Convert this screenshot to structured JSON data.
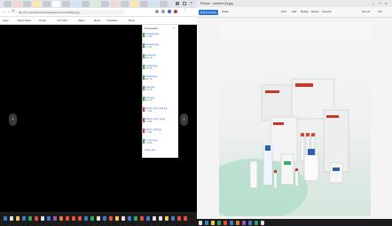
{
  "browser": {
    "url": "file:///C:/Users/admin/Downloads/camera%20(2).jpg",
    "bookmarks": [
      "Apps",
      "Bookmarks",
      "Gmail",
      "YouTube",
      "Maps",
      "News",
      "Translate",
      "Drive"
    ],
    "downloads_title": "Downloads",
    "downloads": [
      {
        "name": "camera(2).jpg",
        "sub": "1.2 MB"
      },
      {
        "name": "camera(1).jpg",
        "sub": "1.1 MB"
      },
      {
        "name": "camera.jpg",
        "sub": "980 KB"
      },
      {
        "name": "image(3).jpg",
        "sub": "870 KB"
      },
      {
        "name": "image(2).jpg",
        "sub": "864 KB"
      },
      {
        "name": "image.jpg",
        "sub": "702 KB"
      },
      {
        "name": "photo.jpg",
        "sub": "655 KB"
      },
      {
        "name": "product_shot_final.jpg",
        "sub": "2.4 MB"
      },
      {
        "name": "product_shot_v2.jpg",
        "sub": "2.3 MB"
      },
      {
        "name": "product_shot.jpg",
        "sub": "2.2 MB"
      },
      {
        "name": "kit_photo.jpg",
        "sub": "1.9 MB"
      }
    ],
    "show_all": "Show all",
    "prev_glyph": "‹",
    "next_glyph": "›"
  },
  "viewer": {
    "title": "Photos - camera (2).jpg",
    "start_label": "Edit & Create",
    "toolbar_items": [
      "Share",
      "Print",
      "Edit",
      "Rotate",
      "Delete",
      "Favorite"
    ],
    "right_labels": [
      "See all",
      "Info"
    ]
  },
  "colors": {
    "accent": "#2b78d6",
    "taskbar": "#1b1b1b",
    "viewer_bg": "#000000"
  }
}
